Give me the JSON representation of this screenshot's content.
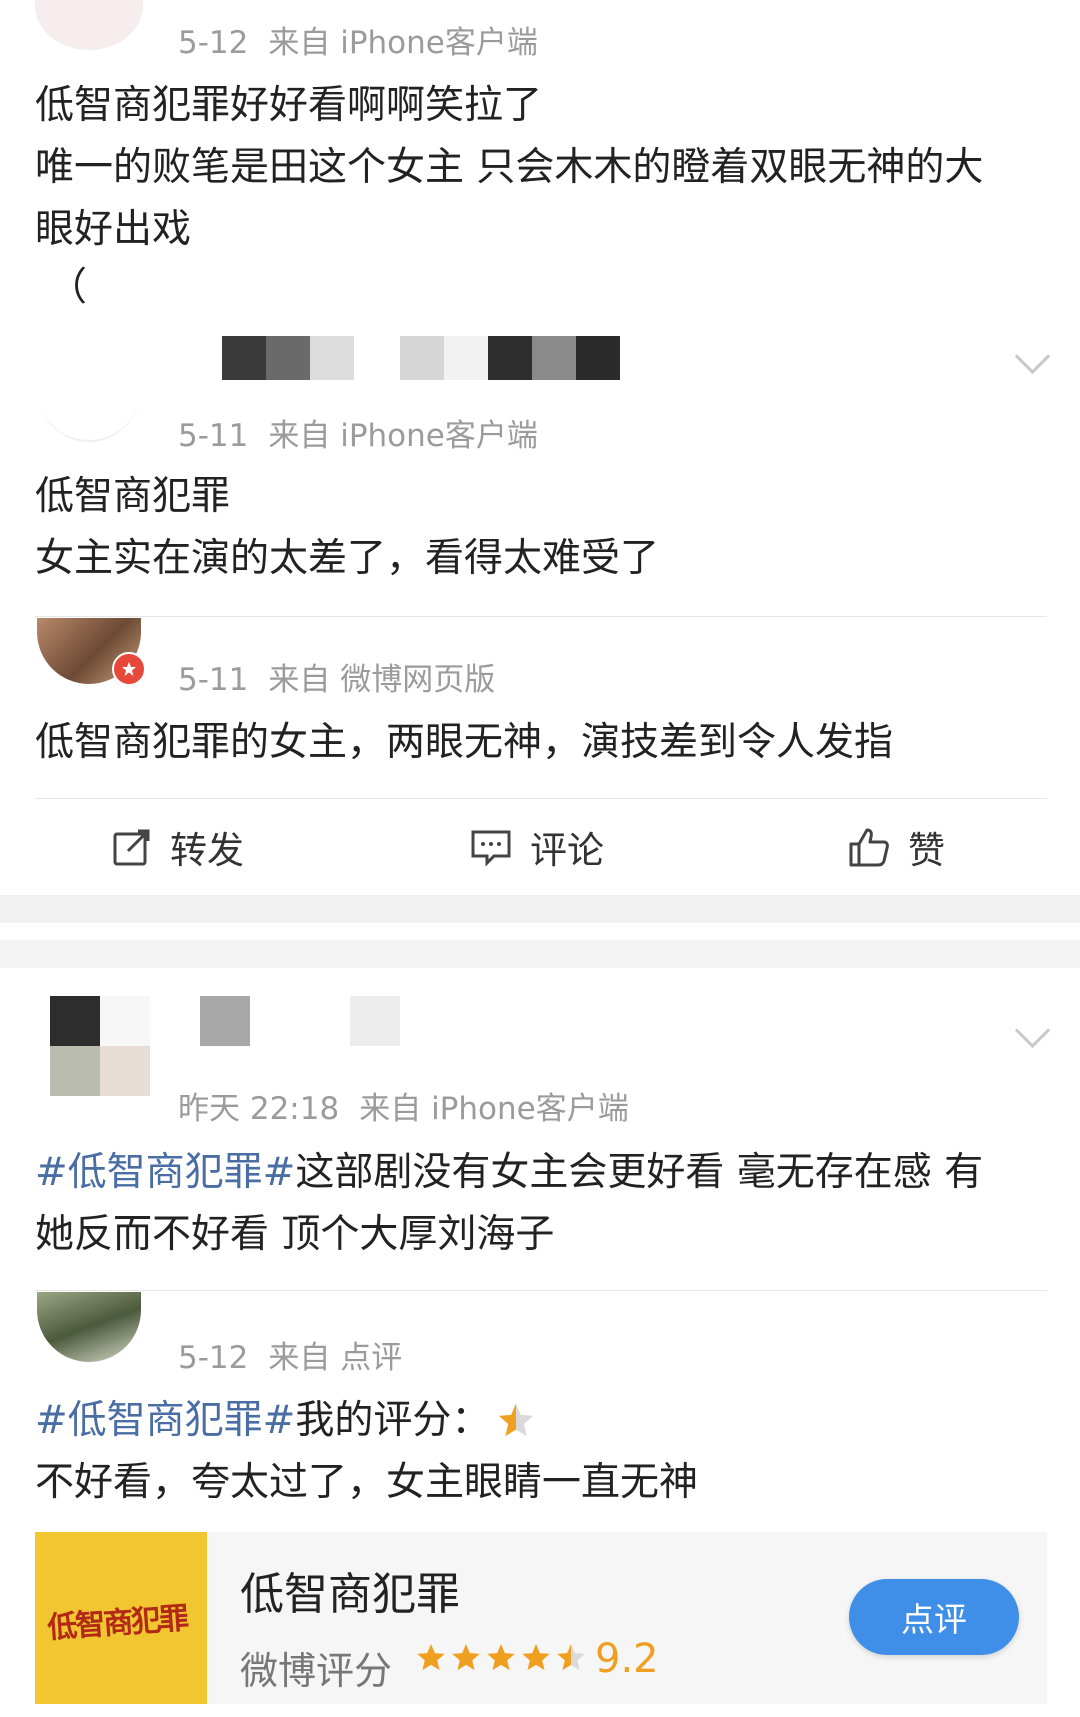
{
  "comments": [
    {
      "date": "5-12",
      "source_prefix": "来自",
      "source": "iPhone客户端",
      "lines": [
        "低智商犯罪好好看啊啊笑拉了",
        "唯一的败笔是田这个女主 只会木木的瞪着双眼无神的大",
        "眼好出戏",
        "（"
      ]
    },
    {
      "date": "5-11",
      "source_prefix": "来自",
      "source": "iPhone客户端",
      "lines": [
        "低智商犯罪",
        "女主实在演的太差了，看得太难受了"
      ]
    },
    {
      "date": "5-11",
      "source_prefix": "来自",
      "source": "微博网页版",
      "lines": [
        "低智商犯罪的女主，两眼无神，演技差到令人发指"
      ]
    },
    {
      "date": "昨天 22:18",
      "source_prefix": "来自",
      "source": "iPhone客户端",
      "hashtag": "#低智商犯罪#",
      "line1_rest": "这部剧没有女主会更好看 毫无存在感 有",
      "line2": "她反而不好看 顶个大厚刘海子"
    },
    {
      "date": "5-12",
      "source_prefix": "来自",
      "source": "点评",
      "hashtag": "#低智商犯罪#",
      "rating_label": " 我的评分：",
      "user_rating_stars": 0.5,
      "line2": "不好看，夸太过了，女主眼睛一直无神"
    }
  ],
  "actions": {
    "repost": "转发",
    "comment": "评论",
    "like": "赞"
  },
  "review_card": {
    "poster_title": "低智商犯罪",
    "title": "低智商犯罪",
    "score_label": "微博评分",
    "score": "9.2",
    "stars_value": 4.5,
    "button": "点评"
  },
  "colors": {
    "hashtag": "#4a6ea3",
    "meta": "#9b9b9b",
    "button": "#3f8ee8",
    "star": "#f0a020"
  }
}
